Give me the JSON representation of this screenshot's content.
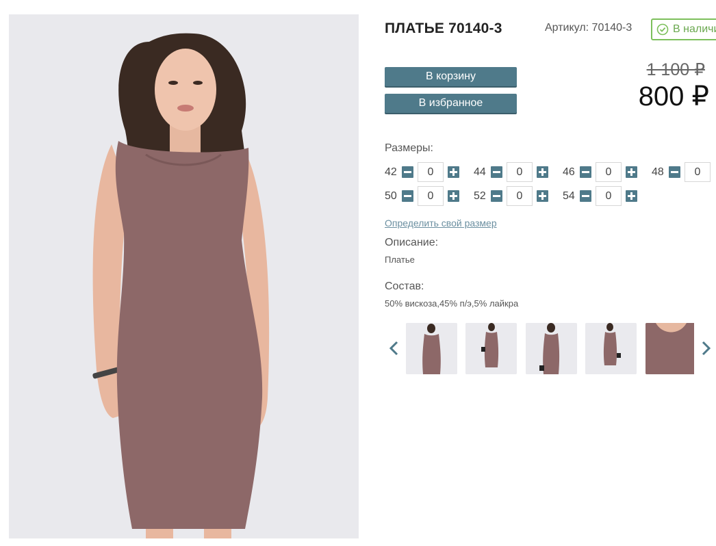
{
  "product": {
    "title": "ПЛАТЬЕ 70140-3",
    "sku": "Артикул: 70140-3",
    "stock": "В наличии",
    "old_price": "1 100 ₽",
    "new_price": "800 ₽"
  },
  "actions": {
    "cart": "В корзину",
    "favorite": "В избранное"
  },
  "sizes": {
    "label": "Размеры:",
    "items": [
      {
        "size": "42",
        "qty": "0"
      },
      {
        "size": "44",
        "qty": "0"
      },
      {
        "size": "46",
        "qty": "0"
      },
      {
        "size": "48",
        "qty": "0"
      },
      {
        "size": "50",
        "qty": "0"
      },
      {
        "size": "52",
        "qty": "0"
      },
      {
        "size": "54",
        "qty": "0"
      }
    ],
    "size_link": "Определить свой размер"
  },
  "description": {
    "label": "Описание:",
    "text": "Платье"
  },
  "composition": {
    "label": "Состав:",
    "text": "50% вискоза,45% п/э,5% лайкра"
  },
  "colors": {
    "accent": "#4f7a8a",
    "stock_green": "#7cbf5b",
    "dress": "#8d6868",
    "link": "#6b8fa0"
  },
  "icons": {
    "stock": "check-circle-icon",
    "prev": "chevron-left-icon",
    "next": "chevron-right-icon"
  }
}
